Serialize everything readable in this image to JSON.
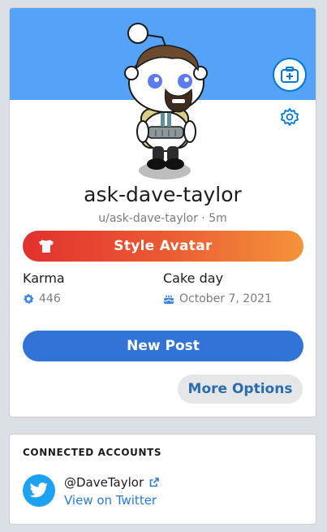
{
  "profile": {
    "display_name": "ask-dave-taylor",
    "username": "u/ask-dave-taylor",
    "age": "5m",
    "style_avatar_label": "Style Avatar",
    "karma_label": "Karma",
    "karma_value": "446",
    "cake_day_label": "Cake day",
    "cake_day_value": "October 7, 2021",
    "new_post_label": "New Post",
    "more_options_label": "More Options"
  },
  "connected_accounts": {
    "title": "CONNECTED ACCOUNTS",
    "twitter_handle": "@DaveTaylor",
    "view_link": "View on Twitter"
  },
  "icons": {
    "add_image": "add-image-icon",
    "settings": "gear-icon",
    "style_avatar": "shirt-icon",
    "karma": "karma-icon",
    "cake_day": "cake-icon",
    "twitter": "twitter-icon",
    "external_link": "external-link-icon"
  },
  "colors": {
    "banner": "#54a3f9",
    "style_avatar_gradient_start": "#e2302e",
    "style_avatar_gradient_end": "#f4933a",
    "new_post": "#3274d6",
    "more_options_bg": "#e4e6e8",
    "link": "#2b7bd6",
    "twitter": "#1da1f2"
  }
}
